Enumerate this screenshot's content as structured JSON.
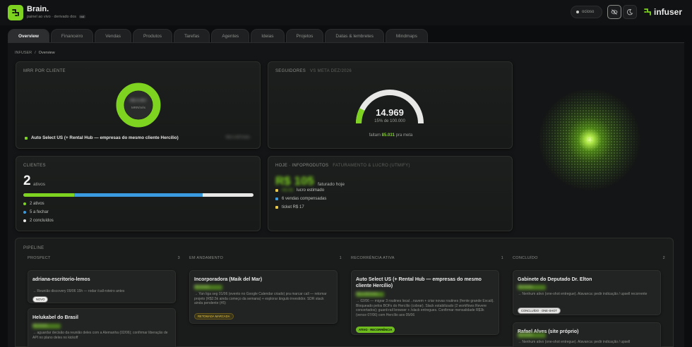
{
  "app": {
    "title": "Brain.",
    "subtitle": "painel ao vivo · derivado dos",
    "subtitle_tag": "md"
  },
  "header": {
    "status_label": "ocioso",
    "brand_name": "infuser"
  },
  "tabs": [
    {
      "label": "Overview",
      "active": true
    },
    {
      "label": "Financeiro",
      "active": false
    },
    {
      "label": "Vendas",
      "active": false
    },
    {
      "label": "Produtos",
      "active": false
    },
    {
      "label": "Tarefas",
      "active": false
    },
    {
      "label": "Agentes",
      "active": false
    },
    {
      "label": "Ideias",
      "active": false
    },
    {
      "label": "Projetos",
      "active": false
    },
    {
      "label": "Datas & lembretes",
      "active": false
    },
    {
      "label": "Mindmaps",
      "active": false
    }
  ],
  "breadcrumb": {
    "root": "INFUSER",
    "sep": "/",
    "current": "Overview"
  },
  "mrr": {
    "title": "MRR POR CLIENTE",
    "center_value": "R$ 4.497",
    "center_label": "MRR/mês",
    "legend": [
      {
        "label": "Auto Select US (+ Rental Hub — empresas do mesmo cliente Hercílio)",
        "color": "#7ed321"
      }
    ],
    "legend_value": "R$ 4.497/mês"
  },
  "followers": {
    "title": "SEGUIDORES",
    "subtitle": "VS META DEZ/2026",
    "value": "14.969",
    "progress_pct": 15,
    "progress_label": "15% de 100.000",
    "remaining_prefix": "faltam",
    "remaining_value": "85.031",
    "remaining_suffix": "pra meta"
  },
  "clients": {
    "title": "CLIENTES",
    "count": "2",
    "count_label": "ativos",
    "bar_segments": [
      {
        "value": 2,
        "color": "#7ed321"
      },
      {
        "value": 5,
        "color": "#3b9be0"
      },
      {
        "value": 2,
        "color": "#e8e8e6"
      }
    ],
    "legend": [
      {
        "label": "2 ativos",
        "color": "#7ed321"
      },
      {
        "label": "5 a fechar",
        "color": "#3b9be0"
      },
      {
        "label": "2 concluídos",
        "color": "#e8e8e6"
      }
    ]
  },
  "today": {
    "title": "HOJE · INFOPRODUTOS",
    "subtitle": "FATURAMENTO & LUCRO (UTMIFY)",
    "big_value": "R$ 105",
    "big_label": "faturado hoje",
    "items": [
      {
        "value": "R$ 48",
        "label": "lucro estimado",
        "color": "#e8c84a"
      },
      {
        "value": "",
        "label": "6 vendas compensadas",
        "color": "#3b9be0"
      },
      {
        "value": "",
        "label": "ticket R$ 17",
        "color": "#e8c84a"
      }
    ]
  },
  "pipeline": {
    "title": "PIPELINE",
    "columns": [
      {
        "name": "PROSPECT",
        "count": "3",
        "deals": [
          {
            "title": "adriana-escritorio-lemos",
            "value": "",
            "note": "→ Reunião discovery 09/06 15h — rodar /call-roteiro antes",
            "badge": "NOVO",
            "badge_style": "white"
          },
          {
            "title": "Helukabel do Brasil",
            "value": "R$ 0/mês",
            "note": "→ aguardar decisão da reunião deles com a Alemanha (02/06); confirmar liberação de API no plano deles no kickoff",
            "badge": "",
            "badge_style": ""
          }
        ]
      },
      {
        "name": "EM ANDAMENTO",
        "count": "1",
        "deals": [
          {
            "title": "Incorporadora (Maik del Mar)",
            "value": "R$ 0/mês",
            "note": "→ Yan liga seg 01/06 (evento no Google Calendar criado) pra marcar call — retomar projeto (R$2.5k ainda começo da semana) + explorar ângulo investidor. SDR stack ainda pendente (#5)",
            "badge": "RETOMADA MARCADA",
            "badge_style": "amber"
          }
        ]
      },
      {
        "name": "RECORRÊNCIA ATIVA",
        "count": "1",
        "deals": [
          {
            "title": "Auto Select US (+ Rental Hub — empresas do mesmo cliente Hercílio)",
            "value": "R$ 4.497/mês",
            "note": "→ 02/06 — migrar 3 routines local→nuvem + criar novas routines (frente grande Excali). Bloqueado pelos BOFs do Hercílio (cobrar). Slack estabilizado (2 workflows Revere concertados); guard-rail browser + /slack entregues. Confirmar mensalidade R$3k (vence 07/06) com Hercílio aos 05/06",
            "badge": "ATIVO · RECORRÊNCIA",
            "badge_style": "green"
          }
        ]
      },
      {
        "name": "CONCLUÍDO",
        "count": "2",
        "deals": [
          {
            "title": "Gabinete do Deputado Dr. Elton",
            "value": "R$ 0/mês",
            "note": "→ Nenhum ativo (one-shot entregue). Alavanca: pedir indicação / upsell recorrente",
            "badge": "CONCLUÍDO · ONE-SHOT",
            "badge_style": "gray"
          },
          {
            "title": "Rafael Alves (site próprio)",
            "value": "R$ 0/mês",
            "note": "→ Nenhum ativo (one-shot entregue). Alavanca: pedir indicação / upsell",
            "badge": "",
            "badge_style": ""
          }
        ]
      }
    ]
  }
}
